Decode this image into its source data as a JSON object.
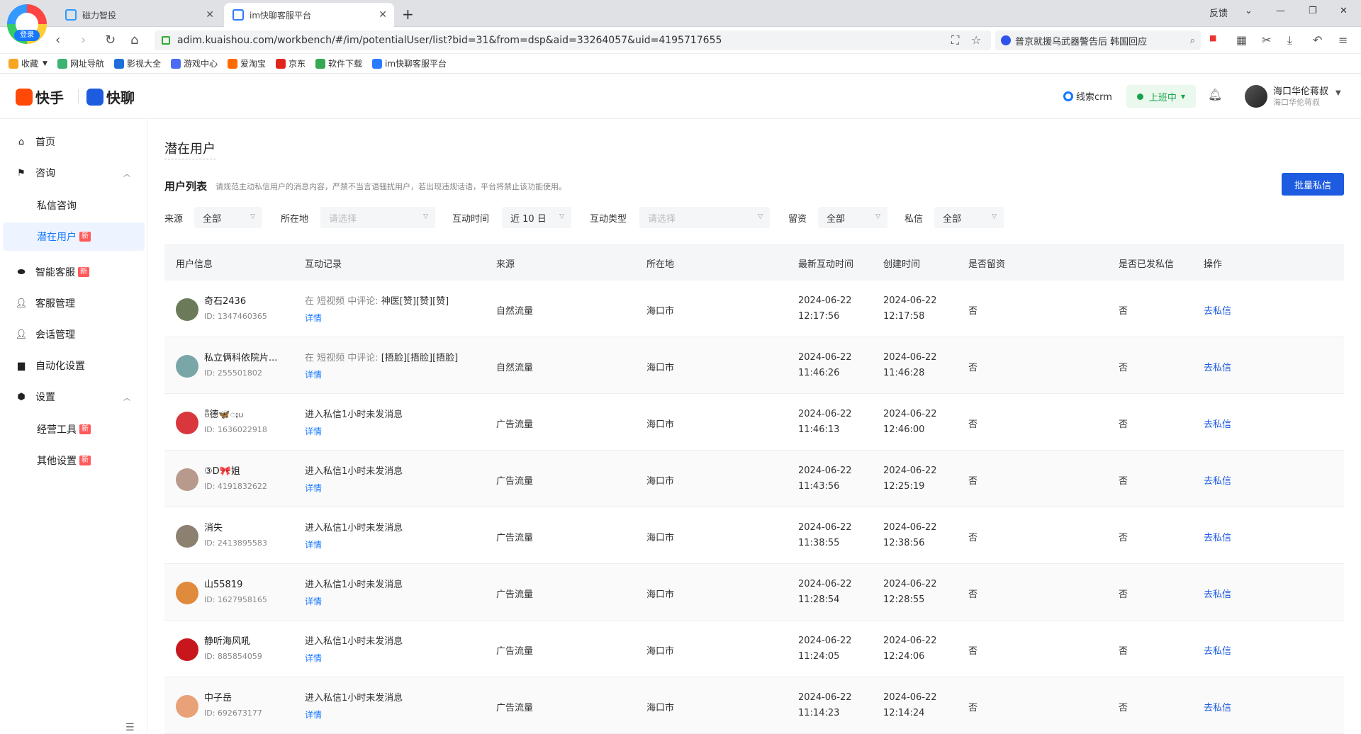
{
  "browser": {
    "login_label": "登录",
    "tabs": [
      {
        "label": "磁力智投"
      },
      {
        "label": "im快聊客服平台"
      }
    ],
    "feedback": "反馈",
    "url": "adim.kuaishou.com/workbench/#/im/potentialUser/list?bid=31&from=dsp&aid=33264057&uid=4195717655",
    "search_text": "普京就援乌武器警告后 韩国回应",
    "bookmarks": [
      {
        "label": "收藏",
        "color": "#f5a623"
      },
      {
        "label": "网址导航",
        "color": "#3cb371"
      },
      {
        "label": "影视大全",
        "color": "#1e6fd9"
      },
      {
        "label": "游戏中心",
        "color": "#4a6cf7"
      },
      {
        "label": "爱淘宝",
        "color": "#ff6a00"
      },
      {
        "label": "京东",
        "color": "#e1251b"
      },
      {
        "label": "软件下载",
        "color": "#36a852"
      },
      {
        "label": "im快聊客服平台",
        "color": "#2b7bff"
      }
    ]
  },
  "header": {
    "brand_kuaishou": "快手",
    "brand_kuailiao": "快聊",
    "crm": "线索crm",
    "status": "上班中",
    "user_name": "海口华伦蒋叔",
    "user_sub": "海口华伦蒋叔"
  },
  "sidebar": {
    "items": [
      {
        "label": "首页"
      },
      {
        "label": "咨询"
      },
      {
        "label": "私信咨询"
      },
      {
        "label": "潜在用户",
        "badge": "新"
      },
      {
        "label": "智能客服",
        "badge": "新"
      },
      {
        "label": "客服管理"
      },
      {
        "label": "会话管理"
      },
      {
        "label": "自动化设置"
      },
      {
        "label": "设置"
      },
      {
        "label": "经营工具",
        "badge": "新"
      },
      {
        "label": "其他设置",
        "badge": "新"
      }
    ]
  },
  "main": {
    "page_title": "潜在用户",
    "list_title": "用户列表",
    "list_note": "请规范主动私信用户的消息内容，严禁不当言语骚扰用户，若出现违规话语，平台将禁止该功能使用。",
    "batch_button": "批量私信",
    "filters": {
      "source_label": "来源",
      "source_value": "全部",
      "location_label": "所在地",
      "location_placeholder": "请选择",
      "time_label": "互动时间",
      "time_value": "近 10 日",
      "type_label": "互动类型",
      "type_placeholder": "请选择",
      "retain_label": "留资",
      "retain_value": "全部",
      "dm_label": "私信",
      "dm_value": "全部"
    },
    "columns": [
      "用户信息",
      "互动记录",
      "来源",
      "所在地",
      "最新互动时间",
      "创建时间",
      "是否留资",
      "是否已发私信",
      "操作"
    ],
    "detail_label": "详情",
    "rows": [
      {
        "name": "奇石2436",
        "id": "ID: 1347460365",
        "rec_prefix": "在 短视频 中评论: ",
        "rec_main": "神医[赞][赞][赞]",
        "source": "自然流量",
        "location": "海口市",
        "latest_date": "2024-06-22",
        "latest_time": "12:17:56",
        "created_date": "2024-06-22",
        "created_time": "12:17:58",
        "retained": "否",
        "sent": "否",
        "action": "去私信",
        "avatar": "#6b7b5a"
      },
      {
        "name": "私立俩科依院片...",
        "id": "ID: 255501802",
        "rec_prefix": "在 短视频 中评论: ",
        "rec_main": "[捂脸][捂脸][捂脸]",
        "source": "自然流量",
        "location": "海口市",
        "latest_date": "2024-06-22",
        "latest_time": "11:46:26",
        "created_date": "2024-06-22",
        "created_time": "11:46:28",
        "retained": "否",
        "sent": "否",
        "action": "去私信",
        "avatar": "#7aa6a8"
      },
      {
        "name": "ဗီ德🦋ႏပ",
        "id": "ID: 1636022918",
        "rec_prefix": "",
        "rec_main": "进入私信1小时未发消息",
        "source": "广告流量",
        "location": "海口市",
        "latest_date": "2024-06-22",
        "latest_time": "11:46:13",
        "created_date": "2024-06-22",
        "created_time": "12:46:00",
        "retained": "否",
        "sent": "否",
        "action": "去私信",
        "avatar": "#d9363e"
      },
      {
        "name": "③D🎀姐",
        "id": "ID: 4191832622",
        "rec_prefix": "",
        "rec_main": "进入私信1小时未发消息",
        "source": "广告流量",
        "location": "海口市",
        "latest_date": "2024-06-22",
        "latest_time": "11:43:56",
        "created_date": "2024-06-22",
        "created_time": "12:25:19",
        "retained": "否",
        "sent": "否",
        "action": "去私信",
        "avatar": "#b89a8c"
      },
      {
        "name": "消失",
        "id": "ID: 2413895583",
        "rec_prefix": "",
        "rec_main": "进入私信1小时未发消息",
        "source": "广告流量",
        "location": "海口市",
        "latest_date": "2024-06-22",
        "latest_time": "11:38:55",
        "created_date": "2024-06-22",
        "created_time": "12:38:56",
        "retained": "否",
        "sent": "否",
        "action": "去私信",
        "avatar": "#8c8070"
      },
      {
        "name": "山55819",
        "id": "ID: 1627958165",
        "rec_prefix": "",
        "rec_main": "进入私信1小时未发消息",
        "source": "广告流量",
        "location": "海口市",
        "latest_date": "2024-06-22",
        "latest_time": "11:28:54",
        "created_date": "2024-06-22",
        "created_time": "12:28:55",
        "retained": "否",
        "sent": "否",
        "action": "去私信",
        "avatar": "#e08a3c"
      },
      {
        "name": "静听海风吼",
        "id": "ID: 885854059",
        "rec_prefix": "",
        "rec_main": "进入私信1小时未发消息",
        "source": "广告流量",
        "location": "海口市",
        "latest_date": "2024-06-22",
        "latest_time": "11:24:05",
        "created_date": "2024-06-22",
        "created_time": "12:24:06",
        "retained": "否",
        "sent": "否",
        "action": "去私信",
        "avatar": "#c8161d"
      },
      {
        "name": "中子岳",
        "id": "ID: 692673177",
        "rec_prefix": "",
        "rec_main": "进入私信1小时未发消息",
        "source": "广告流量",
        "location": "海口市",
        "latest_date": "2024-06-22",
        "latest_time": "11:14:23",
        "created_date": "2024-06-22",
        "created_time": "12:14:24",
        "retained": "否",
        "sent": "否",
        "action": "去私信",
        "avatar": "#e9a178"
      }
    ]
  }
}
